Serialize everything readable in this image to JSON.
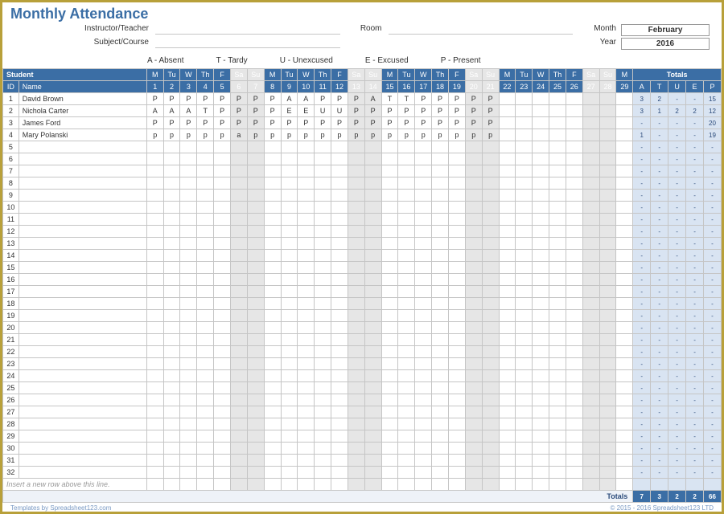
{
  "title": "Monthly Attendance",
  "meta": {
    "instructor_label": "Instructor/Teacher",
    "subject_label": "Subject/Course",
    "room_label": "Room",
    "month_label": "Month",
    "year_label": "Year",
    "month": "February",
    "year": "2016"
  },
  "legend": {
    "a": "A  - Absent",
    "t": "T  - Tardy",
    "u": "U  - Unexcused",
    "e": "E  - Excused",
    "p": "P  - Present"
  },
  "headers": {
    "student": "Student",
    "id": "ID",
    "name": "Name",
    "totals": "Totals",
    "tot_cols": [
      "A",
      "T",
      "U",
      "E",
      "P"
    ]
  },
  "days": {
    "dow": [
      "M",
      "Tu",
      "W",
      "Th",
      "F",
      "Sa",
      "Su",
      "M",
      "Tu",
      "W",
      "Th",
      "F",
      "Sa",
      "Su",
      "M",
      "Tu",
      "W",
      "Th",
      "F",
      "Sa",
      "Su",
      "M",
      "Tu",
      "W",
      "Th",
      "F",
      "Sa",
      "Su",
      "M"
    ],
    "num": [
      "1",
      "2",
      "3",
      "4",
      "5",
      "6",
      "7",
      "8",
      "9",
      "10",
      "11",
      "12",
      "13",
      "14",
      "15",
      "16",
      "17",
      "18",
      "19",
      "20",
      "21",
      "22",
      "23",
      "24",
      "25",
      "26",
      "27",
      "28",
      "29"
    ],
    "weekend": [
      false,
      false,
      false,
      false,
      false,
      true,
      true,
      false,
      false,
      false,
      false,
      false,
      true,
      true,
      false,
      false,
      false,
      false,
      false,
      true,
      true,
      false,
      false,
      false,
      false,
      false,
      true,
      true,
      false
    ]
  },
  "students": [
    {
      "id": "1",
      "name": "David Brown",
      "marks": [
        "P",
        "P",
        "P",
        "P",
        "P",
        "P",
        "P",
        "P",
        "A",
        "A",
        "P",
        "P",
        "P",
        "A",
        "T",
        "T",
        "P",
        "P",
        "P",
        "P",
        "P",
        "",
        "",
        "",
        "",
        "",
        "",
        "",
        ""
      ],
      "totals": [
        "3",
        "2",
        "-",
        "-",
        "15"
      ]
    },
    {
      "id": "2",
      "name": "Nichola Carter",
      "marks": [
        "A",
        "A",
        "A",
        "T",
        "P",
        "P",
        "P",
        "P",
        "E",
        "E",
        "U",
        "U",
        "P",
        "P",
        "P",
        "P",
        "P",
        "P",
        "P",
        "P",
        "P",
        "",
        "",
        "",
        "",
        "",
        "",
        "",
        ""
      ],
      "totals": [
        "3",
        "1",
        "2",
        "2",
        "12"
      ]
    },
    {
      "id": "3",
      "name": "James Ford",
      "marks": [
        "P",
        "P",
        "P",
        "P",
        "P",
        "P",
        "P",
        "P",
        "P",
        "P",
        "P",
        "P",
        "P",
        "P",
        "P",
        "P",
        "P",
        "P",
        "P",
        "P",
        "P",
        "",
        "",
        "",
        "",
        "",
        "",
        "",
        ""
      ],
      "totals": [
        "-",
        "-",
        "-",
        "-",
        "20"
      ]
    },
    {
      "id": "4",
      "name": "Mary Polanski",
      "marks": [
        "p",
        "p",
        "p",
        "p",
        "p",
        "a",
        "p",
        "p",
        "p",
        "p",
        "p",
        "p",
        "p",
        "p",
        "p",
        "p",
        "p",
        "p",
        "p",
        "p",
        "p",
        "",
        "",
        "",
        "",
        "",
        "",
        "",
        ""
      ],
      "totals": [
        "1",
        "-",
        "-",
        "-",
        "19"
      ]
    }
  ],
  "empty_ids": [
    "5",
    "6",
    "7",
    "8",
    "9",
    "10",
    "11",
    "12",
    "13",
    "14",
    "15",
    "16",
    "17",
    "18",
    "19",
    "20",
    "21",
    "22",
    "23",
    "24",
    "25",
    "26",
    "27",
    "28",
    "29",
    "30",
    "31",
    "32"
  ],
  "insert_text": "Insert a new row above this line.",
  "footer": {
    "label": "Totals",
    "vals": [
      "7",
      "3",
      "2",
      "2",
      "66"
    ]
  },
  "credits": {
    "left": "Templates by Spreadsheet123.com",
    "right": "© 2015 - 2016 Spreadsheet123 LTD"
  },
  "dash": "-"
}
